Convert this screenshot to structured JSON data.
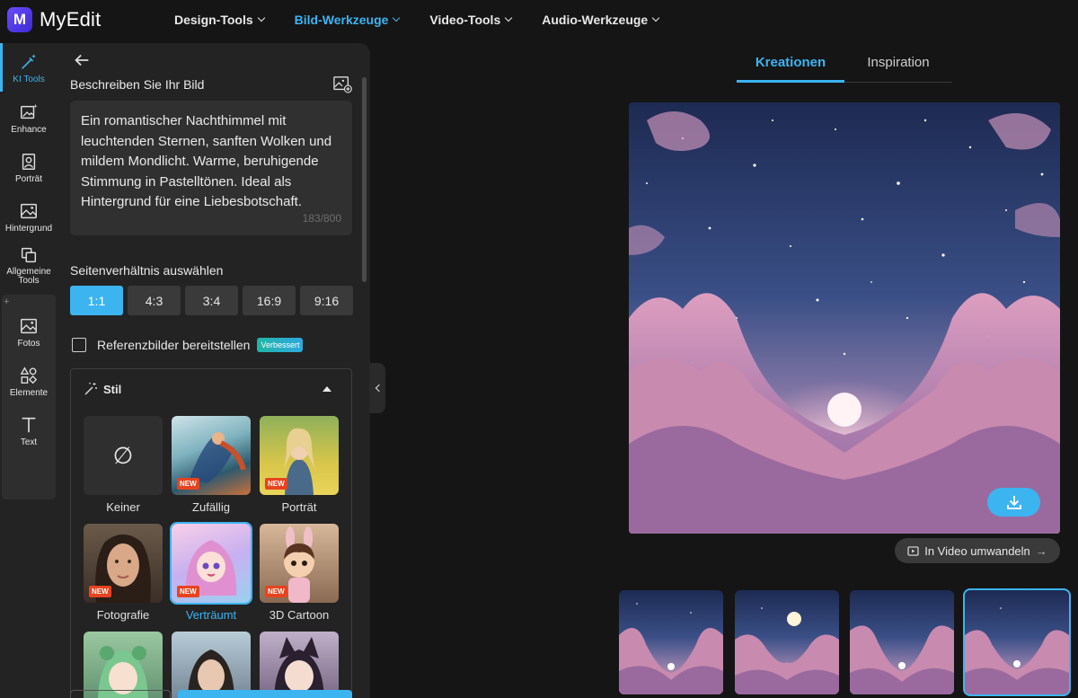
{
  "app": {
    "name": "MyEdit",
    "logo_letter": "M"
  },
  "nav": [
    {
      "label": "Design-Tools",
      "active": false
    },
    {
      "label": "Bild-Werkzeuge",
      "active": true
    },
    {
      "label": "Video-Tools",
      "active": false
    },
    {
      "label": "Audio-Werkzeuge",
      "active": false
    }
  ],
  "rail": [
    {
      "label": "KI Tools",
      "icon": "magic-wand-icon",
      "active": true
    },
    {
      "label": "Enhance",
      "icon": "image-sparkle-icon"
    },
    {
      "label": "Porträt",
      "icon": "portrait-icon"
    },
    {
      "label": "Hintergrund",
      "icon": "background-icon"
    },
    {
      "label": "Allgemeine Tools",
      "icon": "copy-icon"
    },
    {
      "label": "Fotos",
      "icon": "photo-icon"
    },
    {
      "label": "Elemente",
      "icon": "shapes-icon"
    },
    {
      "label": "Text",
      "icon": "text-icon"
    }
  ],
  "rail_plus": "+",
  "panel": {
    "describe_title": "Beschreiben Sie Ihr Bild",
    "prompt": "Ein romantischer Nachthimmel mit leuchtenden Sternen, sanften Wolken und mildem Mondlicht. Warme, beruhigende Stimmung in Pastelltönen. Ideal als Hintergrund für eine Liebesbotschaft.",
    "counter": "183/800",
    "ratio_title": "Seitenverhältnis auswählen",
    "ratios": [
      "1:1",
      "4:3",
      "3:4",
      "16:9",
      "9:16"
    ],
    "selected_ratio": "1:1",
    "reference_label": "Referenzbilder bereitstellen",
    "reference_badge": "Verbessert",
    "style_title": "Stil",
    "styles": [
      {
        "label": "Keiner",
        "new": false,
        "selected": false
      },
      {
        "label": "Zufällig",
        "new": true,
        "selected": false
      },
      {
        "label": "Porträt",
        "new": true,
        "selected": false
      },
      {
        "label": "Fotografie",
        "new": true,
        "selected": false
      },
      {
        "label": "Verträumt",
        "new": true,
        "selected": true
      },
      {
        "label": "3D Cartoon",
        "new": true,
        "selected": false
      }
    ],
    "new_badge": "NEW",
    "none_symbol": "∅"
  },
  "right": {
    "tabs": [
      "Kreationen",
      "Inspiration"
    ],
    "active_tab": "Kreationen",
    "video_button": "In Video umwandeln",
    "video_arrow": "→"
  },
  "colors": {
    "accent": "#3cb4f0",
    "new_badge": "#e8431f",
    "panel_bg": "#232323",
    "page_bg": "#151515"
  }
}
